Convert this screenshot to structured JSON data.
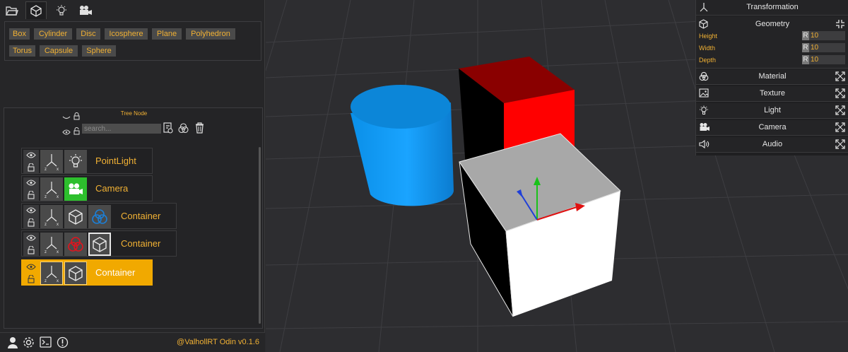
{
  "top_tabs": [
    {
      "icon": "folder-icon"
    },
    {
      "icon": "cube-icon",
      "active": true
    },
    {
      "icon": "lightbulb-icon"
    },
    {
      "icon": "camera-icon"
    }
  ],
  "geometry_buttons": [
    "Box",
    "Cylinder",
    "Disc",
    "Icosphere",
    "Plane",
    "Polyhedron",
    "Torus",
    "Capsule",
    "Sphere"
  ],
  "tree": {
    "title": "Tree Node",
    "search_placeholder": "search...",
    "nodes": [
      {
        "label": "PointLight",
        "icons": [
          "eye-icon",
          "lock-icon",
          "axes-icon",
          "lightbulb-icon"
        ]
      },
      {
        "label": "Camera",
        "icons": [
          "eye-icon",
          "lock-icon",
          "axes-icon",
          "camera-icon"
        ]
      },
      {
        "label": "Container",
        "icons": [
          "eye-icon",
          "lock-icon",
          "axes-icon",
          "cube-icon",
          "material-blue-icon"
        ]
      },
      {
        "label": "Container",
        "icons": [
          "eye-icon",
          "lock-icon",
          "axes-icon",
          "material-red-icon",
          "cube-icon"
        ]
      },
      {
        "label": "Container",
        "icons": [
          "eye-icon",
          "lock-icon",
          "axes-icon",
          "cube-icon"
        ],
        "selected": true
      }
    ]
  },
  "footer": {
    "icons": [
      "user-icon",
      "settings-icon",
      "terminal-icon",
      "info-icon"
    ],
    "version": "@ValhollRT Odin v0.1.6"
  },
  "inspector": {
    "transformation": "Transformation",
    "geometry": {
      "title": "Geometry",
      "props": [
        {
          "label": "Height",
          "r": "R",
          "value": "10"
        },
        {
          "label": "Width",
          "r": "R",
          "value": "10"
        },
        {
          "label": "Depth",
          "r": "R",
          "value": "10"
        }
      ]
    },
    "sections": [
      "Material",
      "Texture",
      "Light",
      "Camera",
      "Audio"
    ]
  },
  "colors": {
    "accent": "#f1b134",
    "selected_row": "#f1a900",
    "cylinder": "#1c9cf0",
    "red_cube": "#ff0000",
    "white_cube": "#ffffff",
    "camera_tile": "#2dbf2d"
  }
}
